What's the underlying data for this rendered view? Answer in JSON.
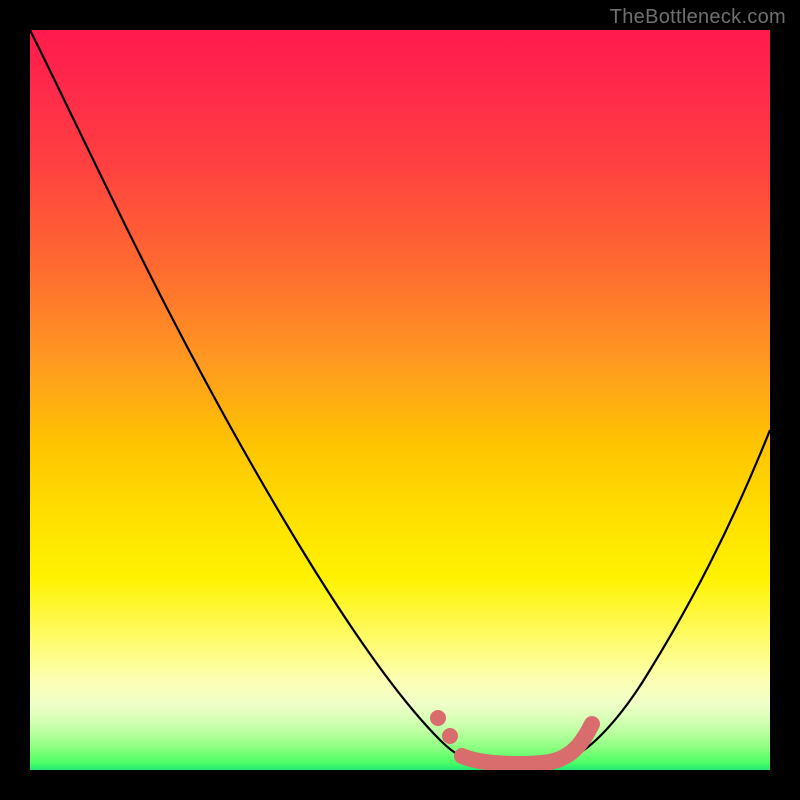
{
  "watermark": "TheBottleneck.com",
  "chart_data": {
    "type": "line",
    "title": "",
    "xlabel": "",
    "ylabel": "",
    "xlim": [
      0,
      100
    ],
    "ylim": [
      0,
      100
    ],
    "series": [
      {
        "name": "bottleneck-curve",
        "x": [
          0,
          5,
          10,
          15,
          20,
          25,
          30,
          35,
          40,
          45,
          50,
          55,
          58,
          60,
          62,
          65,
          68,
          70,
          72,
          75,
          80,
          85,
          90,
          95,
          100
        ],
        "y": [
          100,
          95,
          89,
          82,
          75,
          67,
          59,
          51,
          42,
          33,
          24,
          14,
          8,
          4,
          2,
          1,
          1,
          2,
          4,
          8,
          16,
          25,
          34,
          43,
          52
        ]
      },
      {
        "name": "optimal-band",
        "x": [
          55,
          58,
          60,
          62,
          65,
          68,
          70,
          72
        ],
        "y": [
          8,
          4,
          2,
          1,
          1,
          1,
          2,
          4
        ]
      }
    ],
    "colors": {
      "curve": "#000000",
      "optimal_band": "#d96c6c",
      "gradient_top": "#ff1a4d",
      "gradient_bottom": "#22e873"
    }
  }
}
